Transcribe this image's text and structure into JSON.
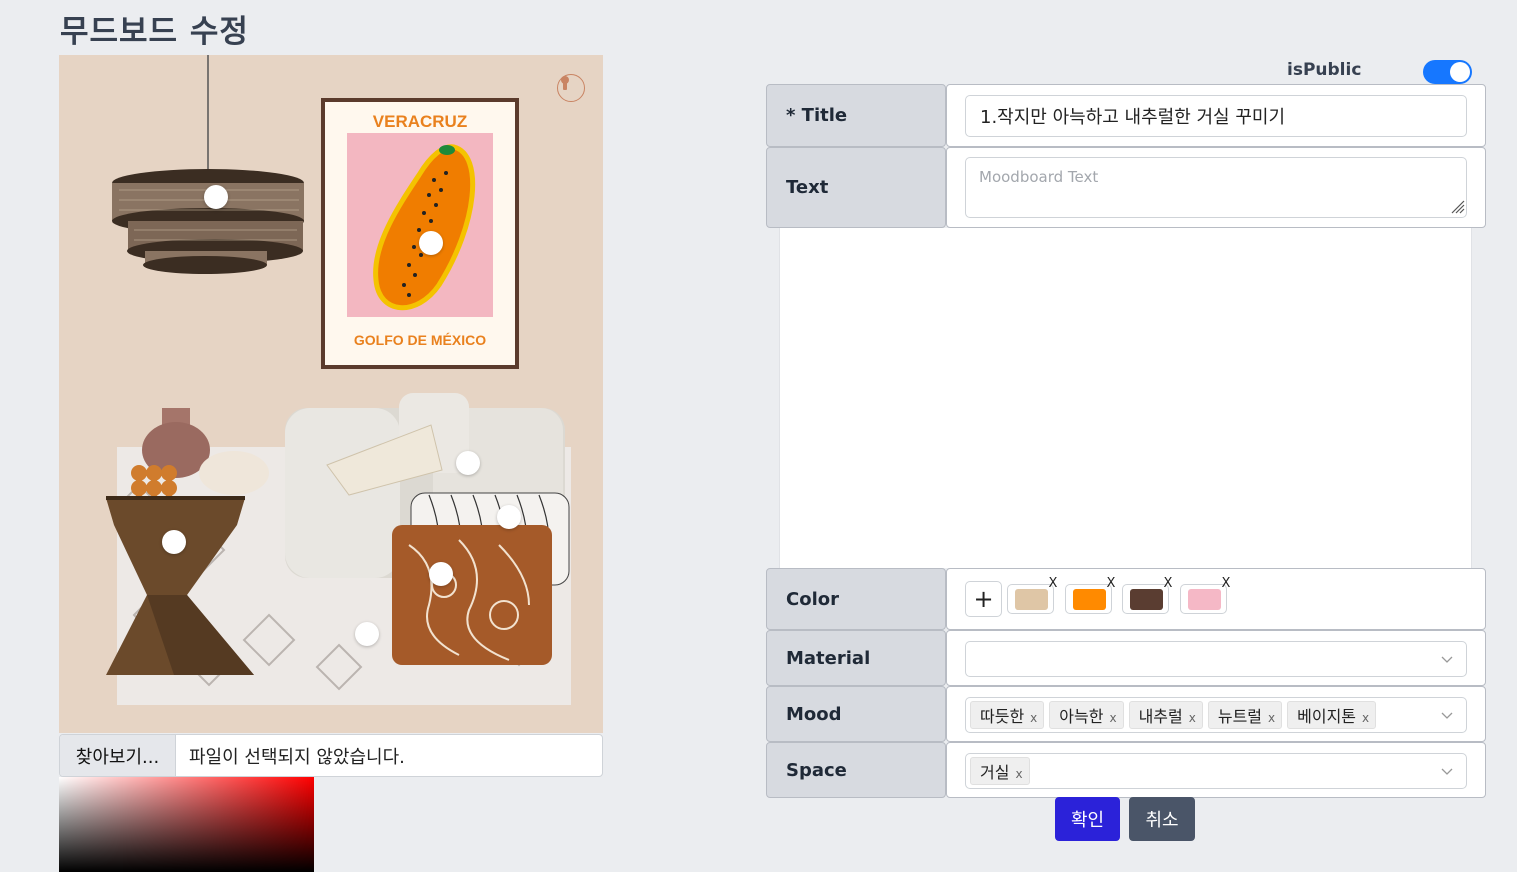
{
  "page": {
    "title": "무드보드 수정"
  },
  "board": {
    "poster_top": "VERACRUZ",
    "poster_bottom": "GOLFO DE MÉXICO"
  },
  "file_input": {
    "button": "찾아보기...",
    "status": "파일이 선택되지 않았습니다."
  },
  "form": {
    "is_public": {
      "label": "isPublic",
      "value": true
    },
    "title": {
      "label": "* Title",
      "value": "1.작지만 아늑하고 내추럴한 거실 꾸미기"
    },
    "text": {
      "label": "Text",
      "placeholder": "Moodboard Text"
    },
    "color": {
      "label": "Color",
      "add_label": "+",
      "remove_label": "X",
      "swatches": [
        "#dfc6a6",
        "#ff8a00",
        "#5a3d31",
        "#f5b8c6"
      ]
    },
    "material": {
      "label": "Material"
    },
    "mood": {
      "label": "Mood",
      "tags": [
        "따듯한",
        "아늑한",
        "내추럴",
        "뉴트럴",
        "베이지톤"
      ],
      "remove_label": "x"
    },
    "space": {
      "label": "Space",
      "tags": [
        "거실"
      ],
      "remove_label": "x"
    }
  },
  "actions": {
    "confirm": "확인",
    "cancel": "취소"
  }
}
